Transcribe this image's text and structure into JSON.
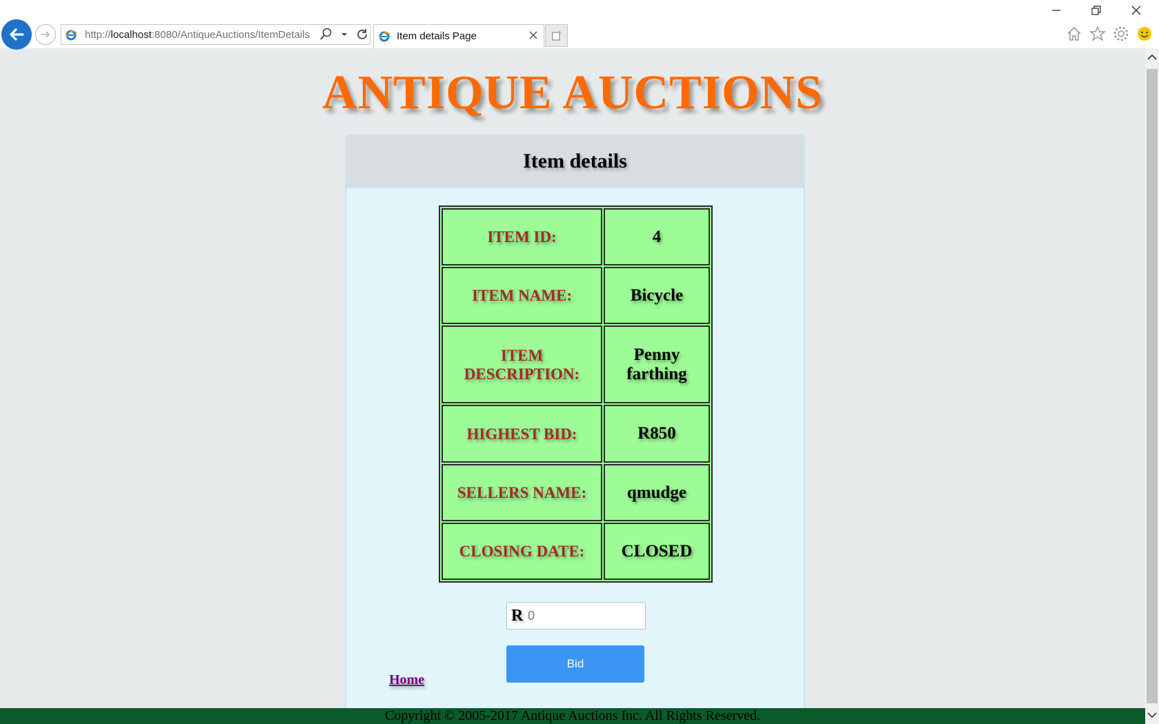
{
  "browser": {
    "url_prefix": "http://",
    "url_host": "localhost",
    "url_rest": ":8080/AntiqueAuctions/ItemDetails",
    "tab_title": "Item details Page"
  },
  "page": {
    "site_title": "ANTIQUE AUCTIONS",
    "panel_title": "Item details",
    "rows": [
      {
        "label": "ITEM ID:",
        "value": "4"
      },
      {
        "label": "ITEM NAME:",
        "value": "Bicycle"
      },
      {
        "label": "ITEM DESCRIPTION:",
        "value": "Penny farthing"
      },
      {
        "label": "HIGHEST BID:",
        "value": "R850"
      },
      {
        "label": "SELLERS NAME:",
        "value": "qmudge"
      },
      {
        "label": "CLOSING DATE:",
        "value": "CLOSED"
      }
    ],
    "bid_prefix": "R",
    "bid_placeholder": "0",
    "bid_button": "Bid",
    "home_link": "Home",
    "footer": "Copyright © 2005-2017 Antique Auctions Inc. All Rights Reserved."
  },
  "colors": {
    "title": "#ff6a00",
    "label": "#a52a2a",
    "table_bg": "#9dfc96",
    "button": "#3a95f3",
    "footer_bg": "#0b5a2b"
  }
}
